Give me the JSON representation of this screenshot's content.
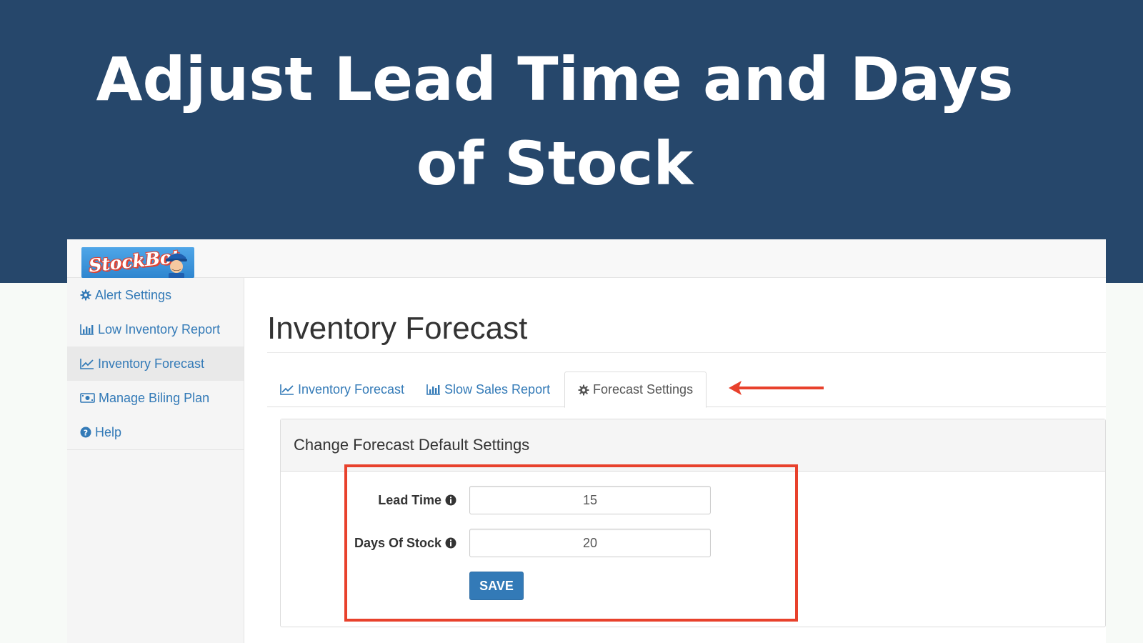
{
  "banner": {
    "title_line1": "Adjust Lead Time and Days",
    "title_line2": "of Stock",
    "background_color": "#26476b"
  },
  "app": {
    "logo": {
      "text": "StockBot",
      "icon": "stockbot-mascot-logo"
    },
    "sidebar": {
      "items": [
        {
          "label": "Alert Settings",
          "icon": "gear-icon",
          "active": false
        },
        {
          "label": "Low Inventory Report",
          "icon": "bar-chart-icon",
          "active": false
        },
        {
          "label": "Inventory Forecast",
          "icon": "line-chart-icon",
          "active": true
        },
        {
          "label": "Manage Biling Plan",
          "icon": "money-icon",
          "active": false
        },
        {
          "label": "Help",
          "icon": "question-circle-icon",
          "active": false
        }
      ]
    },
    "main": {
      "page_title": "Inventory Forecast",
      "tabs": [
        {
          "label": "Inventory Forecast",
          "icon": "line-chart-icon",
          "active": false
        },
        {
          "label": "Slow Sales Report",
          "icon": "bar-chart-icon",
          "active": false
        },
        {
          "label": "Forecast Settings",
          "icon": "gear-icon",
          "active": true
        }
      ],
      "panel": {
        "heading": "Change Forecast Default Settings",
        "fields": [
          {
            "label": "Lead Time",
            "value": "15",
            "icon": "info-circle-icon"
          },
          {
            "label": "Days Of Stock",
            "value": "20",
            "icon": "info-circle-icon"
          }
        ],
        "save_label": "SAVE"
      }
    }
  },
  "annotations": {
    "arrow_color": "#e8412c",
    "highlight_color": "#e8412c"
  },
  "colors": {
    "link": "#337ab7",
    "primary_button": "#337ab7"
  }
}
